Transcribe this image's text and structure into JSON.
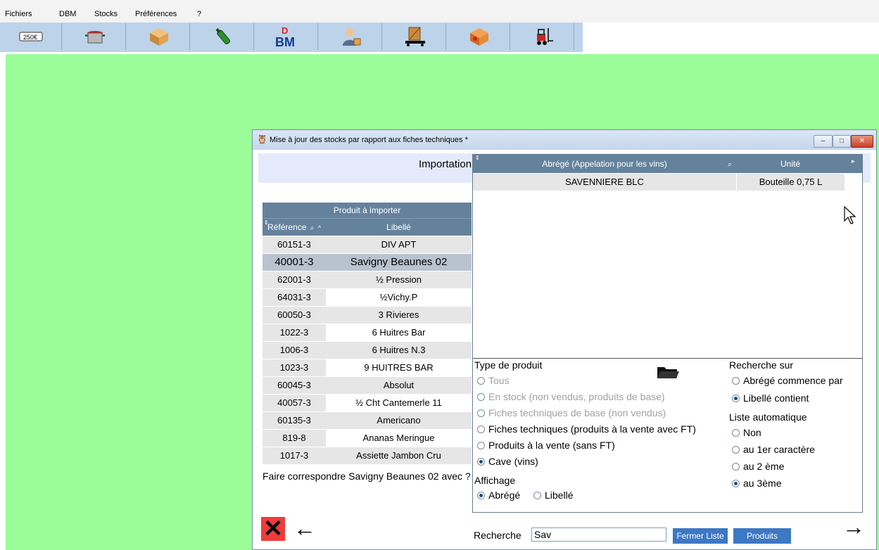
{
  "menu": [
    "Fichiers",
    "DBM",
    "Stocks",
    "Préférences",
    "?"
  ],
  "toolbar": {
    "icons": [
      "price-tag-icon",
      "cooking-pot-icon",
      "box-icon",
      "bottle-icon",
      "dbm-logo-icon",
      "user-box-icon",
      "pallet-icon",
      "package-icon",
      "forklift-icon"
    ]
  },
  "window": {
    "title": "Mise à jour des stocks par rapport aux fiches techniques *",
    "header": "Importation",
    "table": {
      "group_header": "Produit à importer",
      "col_ref": "Référence",
      "col_label": "Libellé",
      "rows": [
        {
          "ref": "60151-3",
          "label": "DIV APT"
        },
        {
          "ref": "40001-3",
          "label": "Savigny Beaunes 02"
        },
        {
          "ref": "62001-3",
          "label": "½ Pression"
        },
        {
          "ref": "64031-3",
          "label": "½Vichy.P"
        },
        {
          "ref": "60050-3",
          "label": "3 Rivieres"
        },
        {
          "ref": "1022-3",
          "label": "6 Huitres Bar"
        },
        {
          "ref": "1006-3",
          "label": "6 Huitres N.3"
        },
        {
          "ref": "1023-3",
          "label": "9 HUITRES BAR"
        },
        {
          "ref": "60045-3",
          "label": "Absolut"
        },
        {
          "ref": "40057-3",
          "label": "½ Cht Cantemerle 11"
        },
        {
          "ref": "60135-3",
          "label": "Americano"
        },
        {
          "ref": "819-8",
          "label": "Ananas Meringue"
        },
        {
          "ref": "1017-3",
          "label": "Assiette Jambon Cru"
        }
      ]
    },
    "question": "Faire correspondre Savigny Beaunes 02 avec ?",
    "popup": {
      "col_abrege": "Abrégé (Appelation pour les vins)",
      "col_unite": "Unité",
      "row": {
        "abrege": "SAVENNIERE BLC",
        "unite": "Bouteille 0,75 L"
      },
      "type_title": "Type de produit",
      "types": [
        {
          "label": "Tous",
          "disabled": true,
          "checked": false
        },
        {
          "label": "En stock (non vendus, produits de base)",
          "disabled": true,
          "checked": false
        },
        {
          "label": "Fiches techniques de base (non vendus)",
          "disabled": true,
          "checked": false
        },
        {
          "label": "Fiches techniques (produits à la vente avec FT)",
          "disabled": false,
          "checked": false
        },
        {
          "label": "Produits à la vente (sans FT)",
          "disabled": false,
          "checked": false
        },
        {
          "label": "Cave (vins)",
          "disabled": false,
          "checked": true
        }
      ],
      "affichage_title": "Affichage",
      "affichage": [
        {
          "label": "Abrégé",
          "checked": true
        },
        {
          "label": "Libellé",
          "checked": false
        }
      ],
      "recherche_title": "Recherche sur",
      "recherche": [
        {
          "label": "Abrégé commence par",
          "checked": false
        },
        {
          "label": "Libellé contient",
          "checked": true
        }
      ],
      "liste_title": "Liste automatique",
      "liste": [
        {
          "label": "Non",
          "checked": false
        },
        {
          "label": "au 1er caractère",
          "checked": false
        },
        {
          "label": "au 2 ème",
          "checked": false
        },
        {
          "label": "au 3ème",
          "checked": true
        }
      ]
    },
    "search_label": "Recherche",
    "search_value": "Sav",
    "btn_close_list": "Fermer Liste",
    "btn_products": "Produits"
  }
}
